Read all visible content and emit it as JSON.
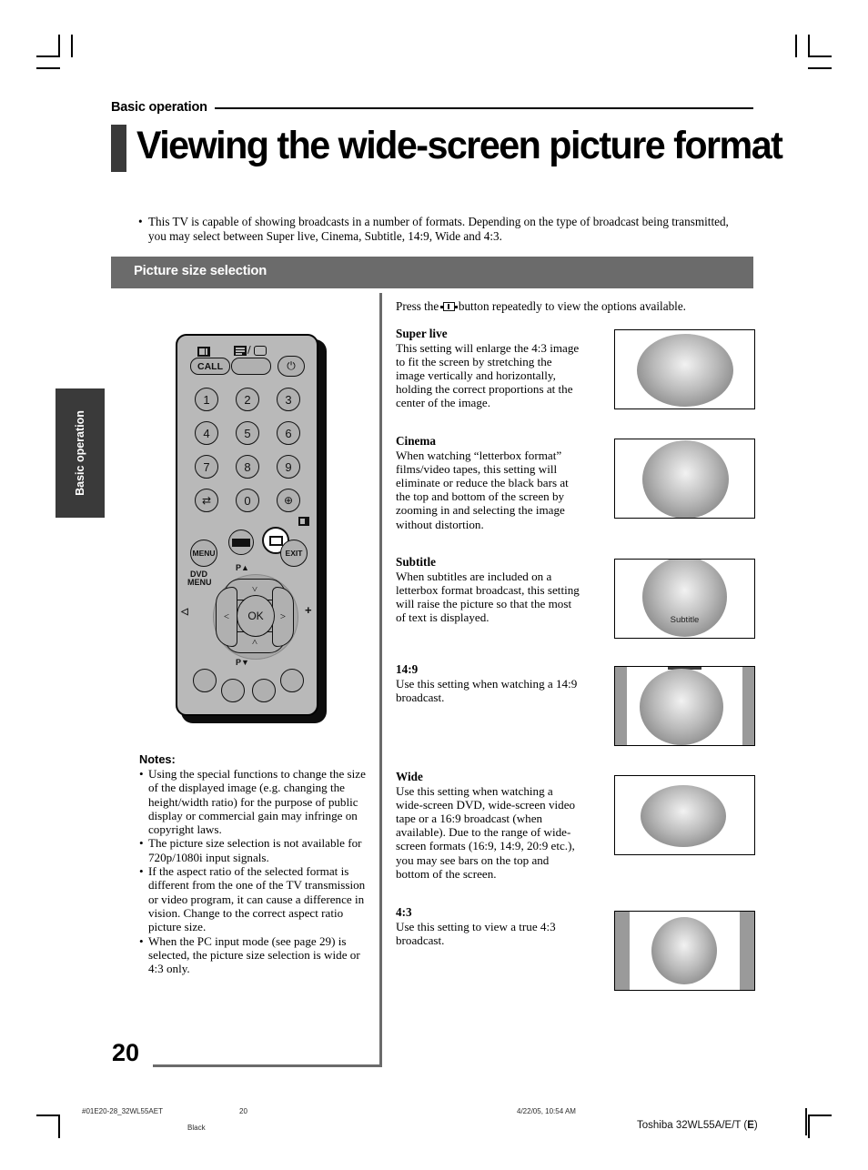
{
  "header": {
    "kicker": "Basic operation",
    "title": "Viewing the wide-screen picture format"
  },
  "intro": {
    "bullet": "•",
    "text": "This TV is capable of showing broadcasts in a number of formats. Depending on the type of broadcast being transmitted, you may select between Super live, Cinema, Subtitle, 14:9, Wide and 4:3."
  },
  "section": {
    "title": "Picture size selection"
  },
  "side_tab": {
    "label": "Basic operation"
  },
  "press_line": {
    "before": "Press the",
    "icon": "picture-size-icon",
    "after": "button repeatedly to view the options available."
  },
  "remote": {
    "buttons": {
      "call": "CALL",
      "text_tv_icon": "teletext-icon",
      "call_icon": "info-icon",
      "power_icon": "power-icon",
      "num1": "1",
      "num2": "2",
      "num3": "3",
      "num4": "4",
      "num5": "5",
      "num6": "6",
      "num7": "7",
      "num8": "8",
      "num9": "9",
      "num0": "0",
      "swap_icon": "swap-icon",
      "input_icon": "input-source-icon",
      "subpage_icon": "subpage-icon",
      "menu": "MENU",
      "dvd_menu": "DVD\nMENU",
      "dvd_menu_line1": "DVD",
      "dvd_menu_line2": "MENU",
      "exit": "EXIT",
      "freeze_icon": "freeze-icon",
      "picsize_icon": "picture-size-icon",
      "ok": "OK",
      "p_up": "P",
      "p_down": "P",
      "vol_down": "–",
      "vol_up": "+"
    }
  },
  "notes": {
    "heading": "Notes:",
    "items": [
      "Using the special functions to change the size of the displayed image (e.g. changing the height/width ratio) for the purpose of public display or commercial gain may infringe on copyright laws.",
      "The picture size selection is not available for 720p/1080i input signals.",
      "If the aspect ratio of the selected format is different from the one of the TV transmission or video program, it can cause a difference in vision. Change to the correct aspect ratio picture size.",
      "When the PC input mode (see page 29) is selected, the picture size selection is wide or 4:3 only."
    ]
  },
  "formats": [
    {
      "name": "Super live",
      "desc": "This setting will enlarge the 4:3 image to fit the screen by stretching the image vertically and horizontally, holding the correct proportions at the center of the image.",
      "preview": {
        "shape": "wide-ellipse",
        "sidebars": false,
        "topbar": false,
        "caption": ""
      }
    },
    {
      "name": "Cinema",
      "desc": "When watching “letterbox format” films/video tapes, this setting will eliminate or reduce the black bars at the top and bottom of the screen by zooming in and selecting the image without distortion.",
      "preview": {
        "shape": "circle-large",
        "sidebars": false,
        "topbar": false,
        "caption": ""
      }
    },
    {
      "name": "Subtitle",
      "desc": "When subtitles are included on a letterbox format broadcast, this setting will raise the picture so that the most of text is displayed.",
      "preview": {
        "shape": "circle-raised",
        "sidebars": false,
        "topbar": false,
        "caption": "Subtitle"
      }
    },
    {
      "name": "14:9",
      "desc": "Use this setting when watching a 14:9 broadcast.",
      "preview": {
        "shape": "circle-bars",
        "sidebars": true,
        "topbar": true,
        "caption": ""
      }
    },
    {
      "name": "Wide",
      "desc": "Use this setting when watching a wide-screen DVD, wide-screen video tape or a 16:9 broadcast (when available). Due to the range of wide-screen formats (16:9, 14:9, 20:9 etc.), you may see bars on the top and bottom of the screen.",
      "preview": {
        "shape": "ellipse-small",
        "sidebars": false,
        "topbar": false,
        "caption": ""
      }
    },
    {
      "name": "4:3",
      "desc": "Use this setting to view a true 4:3 broadcast.",
      "preview": {
        "shape": "circle-narrow",
        "sidebars": true,
        "topbar": false,
        "caption": ""
      }
    }
  ],
  "page_number": "20",
  "footer": {
    "file": "#01E20-28_32WL55AET",
    "page": "20",
    "color": "Black",
    "timestamp": "4/22/05, 10:54 AM",
    "brand_prefix": "Toshiba 32WL55A/E/T (",
    "brand_bold": "E",
    "brand_suffix": ")"
  }
}
